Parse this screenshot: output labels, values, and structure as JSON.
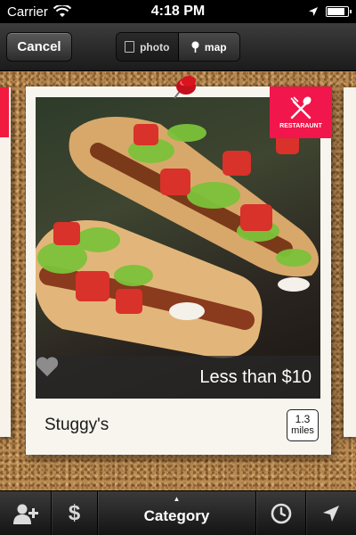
{
  "status_bar": {
    "carrier": "Carrier",
    "time": "4:18 PM"
  },
  "nav": {
    "cancel_label": "Cancel",
    "segments": [
      {
        "label": "photo",
        "icon": "photo-icon",
        "selected": false
      },
      {
        "label": "map",
        "icon": "map-pin-icon",
        "selected": true
      }
    ]
  },
  "card": {
    "category_badge": "RESTARAUNT",
    "category_icon": "fork-knife-icon",
    "rating": {
      "filled": 0,
      "max": 5
    },
    "price_text": "Less than $10",
    "place_name": "Stuggy's",
    "distance_value": "1.3",
    "distance_unit": "miles"
  },
  "toolbar": {
    "add_icon": "add-user-icon",
    "price_symbol": "$",
    "category_label": "Category",
    "caret": "▲",
    "clock_icon": "clock-icon",
    "locate_icon": "location-arrow-icon"
  },
  "colors": {
    "accent_red": "#f1164b",
    "cork": "#b98a52",
    "card": "#f8f5ee"
  }
}
